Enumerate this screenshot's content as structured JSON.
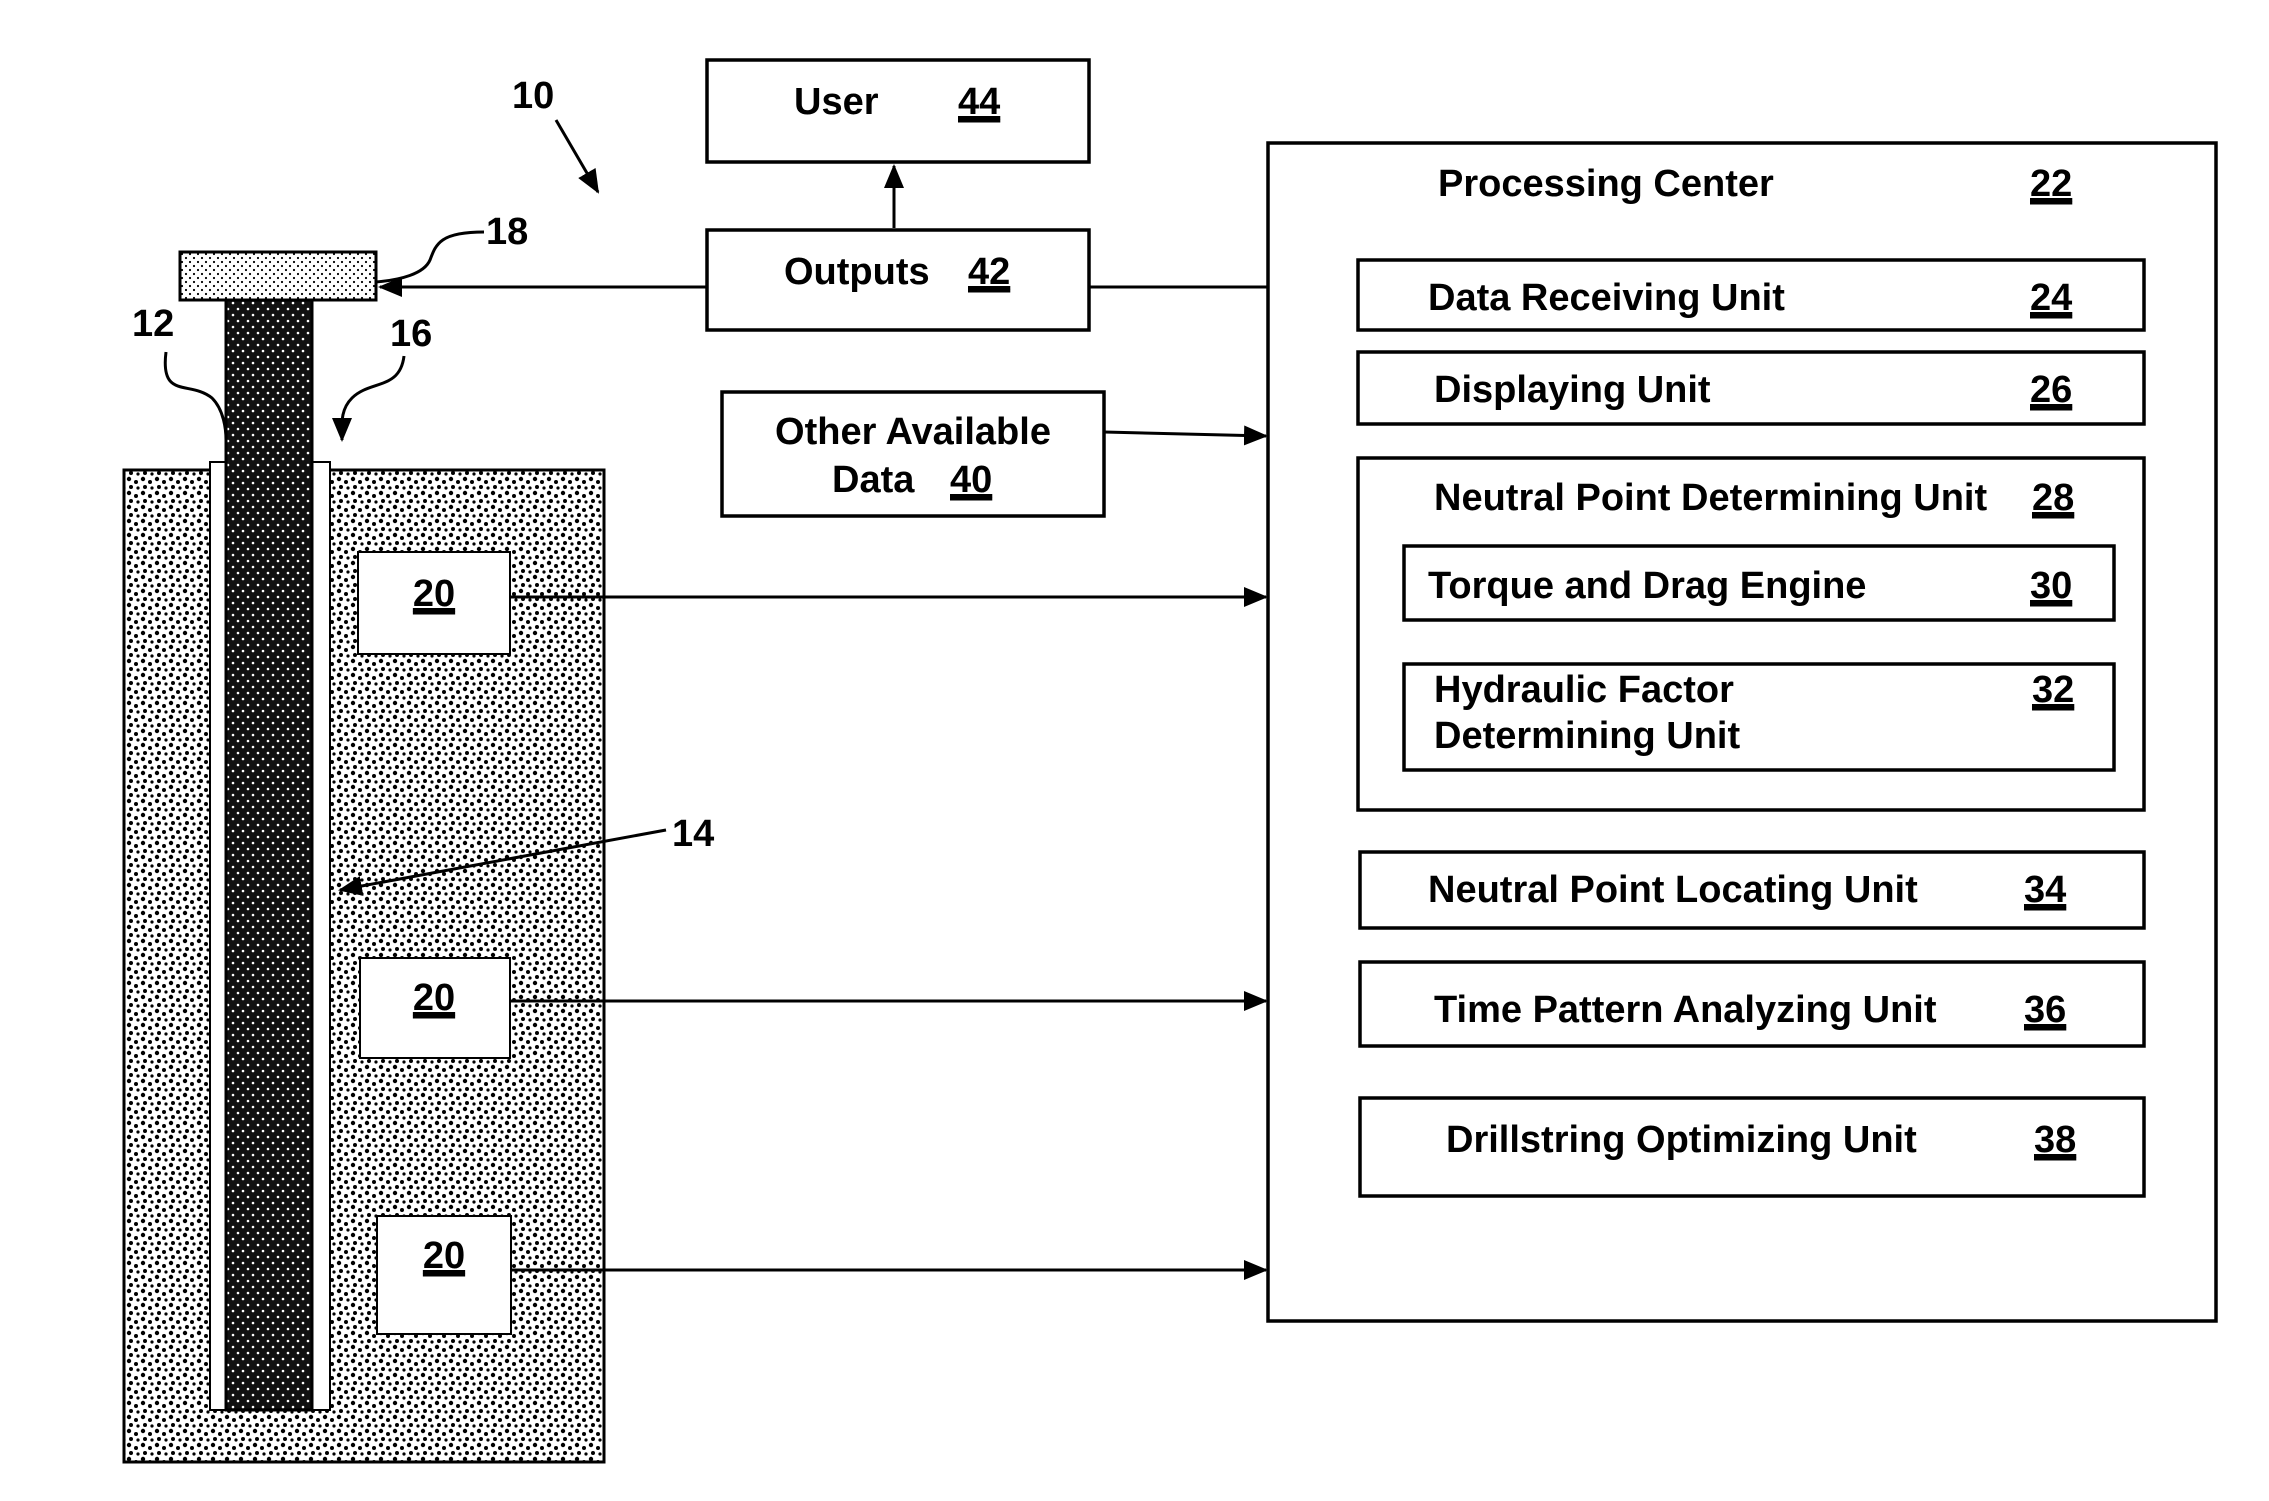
{
  "figure": {
    "system_ref": "10",
    "drillstring_ref": "12",
    "neutral_point_ref": "14",
    "borehole_ref": "16",
    "surface_unit_ref": "18",
    "sensor_ref": "20",
    "sensors": [
      "20",
      "20",
      "20"
    ]
  },
  "user": {
    "label": "User",
    "ref": "44"
  },
  "outputs": {
    "label": "Outputs",
    "ref": "42"
  },
  "other_data": {
    "label_line1": "Other Available",
    "label_line2": "Data",
    "ref": "40"
  },
  "processing_center": {
    "label": "Processing Center",
    "ref": "22",
    "units": [
      {
        "label": "Data Receiving Unit",
        "ref": "24"
      },
      {
        "label": "Displaying Unit",
        "ref": "26"
      }
    ],
    "neutral_point_determining": {
      "label": "Neutral Point Determining Unit",
      "ref": "28",
      "torque_drag": {
        "label": "Torque and Drag Engine",
        "ref": "30"
      },
      "hydraulic": {
        "label_line1": "Hydraulic Factor",
        "label_line2": "Determining Unit",
        "ref": "32"
      }
    },
    "lower_units": [
      {
        "label": "Neutral Point Locating Unit",
        "ref": "34"
      },
      {
        "label": "Time Pattern Analyzing Unit",
        "ref": "36"
      },
      {
        "label": "Drillstring Optimizing Unit",
        "ref": "38"
      }
    ]
  }
}
